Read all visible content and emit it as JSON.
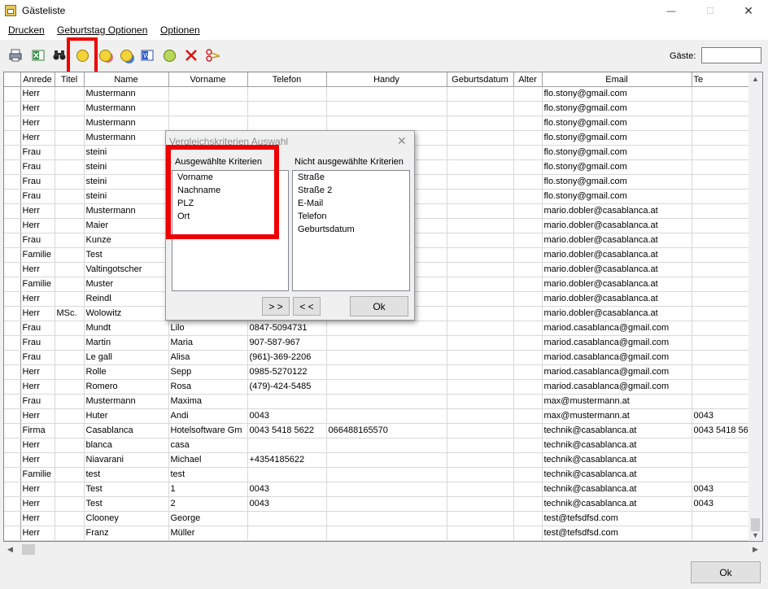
{
  "window": {
    "title": "Gästeliste",
    "minimize": "—",
    "maximize": "☐",
    "close": "✕"
  },
  "menu": [
    "Drucken",
    "Geburtstag Optionen",
    "Optionen"
  ],
  "toolbar": {
    "guests_label": "Gäste:",
    "guests_value": "",
    "icons": [
      "print-icon",
      "excel-export-icon",
      "binoculars-icon",
      "duplicate-search-icon",
      "birthday-person-icon",
      "address-person-icon",
      "word-export-icon",
      "green-face-icon",
      "delete-icon",
      "merge-icon"
    ]
  },
  "table": {
    "columns": [
      "Anrede",
      "Titel",
      "Name",
      "Vorname",
      "Telefon",
      "Handy",
      "Geburtsdatum",
      "Alter",
      "Email",
      "Te"
    ],
    "rows": [
      [
        "Herr",
        "",
        "Mustermann",
        "",
        "",
        "",
        "",
        "",
        "flo.stony@gmail.com",
        ""
      ],
      [
        "Herr",
        "",
        "Mustermann",
        "",
        "",
        "",
        "",
        "",
        "flo.stony@gmail.com",
        ""
      ],
      [
        "Herr",
        "",
        "Mustermann",
        "",
        "",
        "",
        "",
        "",
        "flo.stony@gmail.com",
        ""
      ],
      [
        "Herr",
        "",
        "Mustermann",
        "",
        "",
        "",
        "",
        "",
        "flo.stony@gmail.com",
        ""
      ],
      [
        "Frau",
        "",
        "steini",
        "",
        "",
        "",
        "",
        "",
        "flo.stony@gmail.com",
        ""
      ],
      [
        "Frau",
        "",
        "steini",
        "",
        "",
        "",
        "",
        "",
        "flo.stony@gmail.com",
        ""
      ],
      [
        "Frau",
        "",
        "steini",
        "",
        "",
        "",
        "",
        "",
        "flo.stony@gmail.com",
        ""
      ],
      [
        "Frau",
        "",
        "steini",
        "",
        "",
        "",
        "",
        "",
        "flo.stony@gmail.com",
        ""
      ],
      [
        "Herr",
        "",
        "Mustermann",
        "",
        "",
        "",
        "",
        "",
        "mario.dobler@casablanca.at",
        ""
      ],
      [
        "Herr",
        "",
        "Maier",
        "",
        "",
        "",
        "",
        "",
        "mario.dobler@casablanca.at",
        ""
      ],
      [
        "Frau",
        "",
        "Kunze",
        "",
        "",
        "",
        "",
        "",
        "mario.dobler@casablanca.at",
        ""
      ],
      [
        "Familie",
        "",
        "Test",
        "",
        "",
        "",
        "",
        "",
        "mario.dobler@casablanca.at",
        ""
      ],
      [
        "Herr",
        "",
        "Valtingotscher",
        "",
        "",
        "",
        "",
        "",
        "mario.dobler@casablanca.at",
        ""
      ],
      [
        "Familie",
        "",
        "Muster",
        "",
        "",
        "",
        "",
        "",
        "mario.dobler@casablanca.at",
        ""
      ],
      [
        "Herr",
        "",
        "Reindl",
        "",
        "",
        "",
        "",
        "",
        "mario.dobler@casablanca.at",
        ""
      ],
      [
        "Herr",
        "MSc.",
        "Wolowitz",
        "",
        "",
        "",
        "",
        "",
        "mario.dobler@casablanca.at",
        ""
      ],
      [
        "Frau",
        "",
        "Mundt",
        "Lilo",
        "0847-5094731",
        "",
        "",
        "",
        "mariod.casablanca@gmail.com",
        ""
      ],
      [
        "Frau",
        "",
        "Martin",
        "Maria",
        "907-587-967",
        "",
        "",
        "",
        "mariod.casablanca@gmail.com",
        ""
      ],
      [
        "Frau",
        "",
        "Le gall",
        "Alisa",
        "(961)-369-2206",
        "",
        "",
        "",
        "mariod.casablanca@gmail.com",
        ""
      ],
      [
        "Herr",
        "",
        "Rolle",
        "Sepp",
        "0985-5270122",
        "",
        "",
        "",
        "mariod.casablanca@gmail.com",
        ""
      ],
      [
        "Herr",
        "",
        "Romero",
        "Rosa",
        "(479)-424-5485",
        "",
        "",
        "",
        "mariod.casablanca@gmail.com",
        ""
      ],
      [
        "Frau",
        "",
        "Mustermann",
        "Maxima",
        "",
        "",
        "",
        "",
        "max@mustermann.at",
        ""
      ],
      [
        "Herr",
        "",
        "Huter",
        "Andi",
        "0043",
        "",
        "",
        "",
        "max@mustermann.at",
        "0043"
      ],
      [
        "Firma",
        "",
        "Casablanca",
        "Hotelsoftware Gm",
        "0043 5418 5622",
        "066488165570",
        "",
        "",
        "technik@casablanca.at",
        "0043 5418 56"
      ],
      [
        "Herr",
        "",
        "blanca",
        "casa",
        "",
        "",
        "",
        "",
        "technik@casablanca.at",
        ""
      ],
      [
        "Herr",
        "",
        "Niavarani",
        "Michael",
        "+4354185622",
        "",
        "",
        "",
        "technik@casablanca.at",
        ""
      ],
      [
        "Familie",
        "",
        "test",
        "test",
        "",
        "",
        "",
        "",
        "technik@casablanca.at",
        ""
      ],
      [
        "Herr",
        "",
        "Test",
        "1",
        "0043",
        "",
        "",
        "",
        "technik@casablanca.at",
        "0043"
      ],
      [
        "Herr",
        "",
        "Test",
        "2",
        "0043",
        "",
        "",
        "",
        "technik@casablanca.at",
        "0043"
      ],
      [
        "Herr",
        "",
        "Clooney",
        "George",
        "",
        "",
        "",
        "",
        "test@tefsdfsd.com",
        ""
      ],
      [
        "Herr",
        "",
        "Franz",
        "Müller",
        "",
        "",
        "",
        "",
        "test@tefsdfsd.com",
        ""
      ]
    ]
  },
  "dialog": {
    "title": "Vergleichskriterien Auswahl",
    "selected_label": "Ausgewählte Kriterien",
    "unselected_label": "Nicht ausgewählte Kriterien",
    "selected": [
      "Vorname",
      "Nachname",
      "PLZ",
      "Ort"
    ],
    "unselected": [
      "Straße",
      "Straße 2",
      "E-Mail",
      "Telefon",
      "Geburtsdatum"
    ],
    "add_button": "> >",
    "remove_button": "< <",
    "ok_button": "Ok"
  },
  "footer": {
    "ok_button": "Ok"
  }
}
